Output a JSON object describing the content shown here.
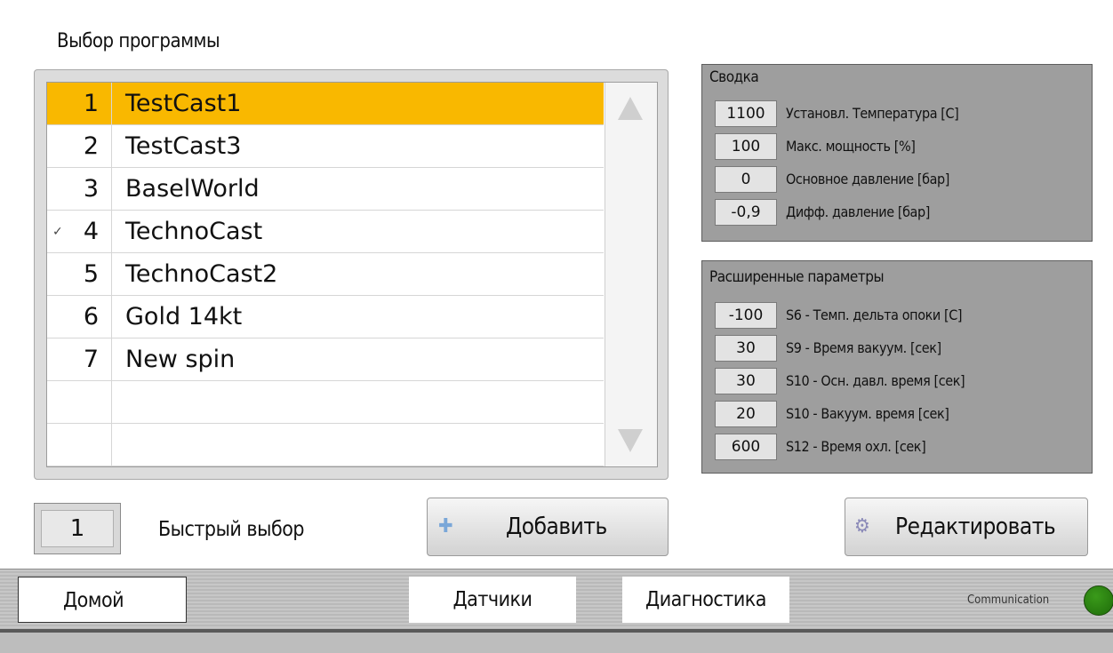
{
  "page": {
    "title": "Выбор программы"
  },
  "programs": [
    {
      "num": "1",
      "name": "TestCast1",
      "check": ""
    },
    {
      "num": "2",
      "name": "TestCast3",
      "check": ""
    },
    {
      "num": "3",
      "name": "BaselWorld",
      "check": ""
    },
    {
      "num": "4",
      "name": "TechnoCast",
      "check": "✓"
    },
    {
      "num": "5",
      "name": "TechnoCast2",
      "check": ""
    },
    {
      "num": "6",
      "name": "Gold 14kt",
      "check": ""
    },
    {
      "num": "7",
      "name": "New spin",
      "check": ""
    },
    {
      "num": "",
      "name": "",
      "check": ""
    },
    {
      "num": "",
      "name": "",
      "check": ""
    }
  ],
  "selected_program": "1",
  "summary": {
    "title": "Сводка",
    "params": [
      {
        "value": "1100",
        "label": "Установл. Температура [C]"
      },
      {
        "value": "100",
        "label": "Макс. мощность [%]"
      },
      {
        "value": "0",
        "label": "Основное давление [бар]"
      },
      {
        "value": "-0,9",
        "label": "Дифф. давление [бар]"
      }
    ]
  },
  "extended": {
    "title": "Расширенные параметры",
    "params": [
      {
        "value": "-100",
        "label": "S6 - Темп. дельта опоки [C]"
      },
      {
        "value": "30",
        "label": "S9 - Время вакуум. [сек]"
      },
      {
        "value": "30",
        "label": "S10 - Осн. давл. время [сек]"
      },
      {
        "value": "20",
        "label": "S10 - Вакуум. время [сек]"
      },
      {
        "value": "600",
        "label": "S12 - Время охл. [сек]"
      }
    ]
  },
  "quick_select": {
    "value": "1",
    "label": "Быстрый выбор"
  },
  "buttons": {
    "add": {
      "label": "Добавить",
      "icon": "plus-icon"
    },
    "edit": {
      "label": "Редактировать",
      "icon": "gear-icon"
    }
  },
  "nav": {
    "home": "Домой",
    "sensors": "Датчики",
    "diagnostics": "Диагностика"
  },
  "status": {
    "communication_label": "Communication",
    "communication_color": "#2a8a12"
  },
  "colors": {
    "selected_row": "#f9b800",
    "panel_bg": "#9e9e9e"
  }
}
